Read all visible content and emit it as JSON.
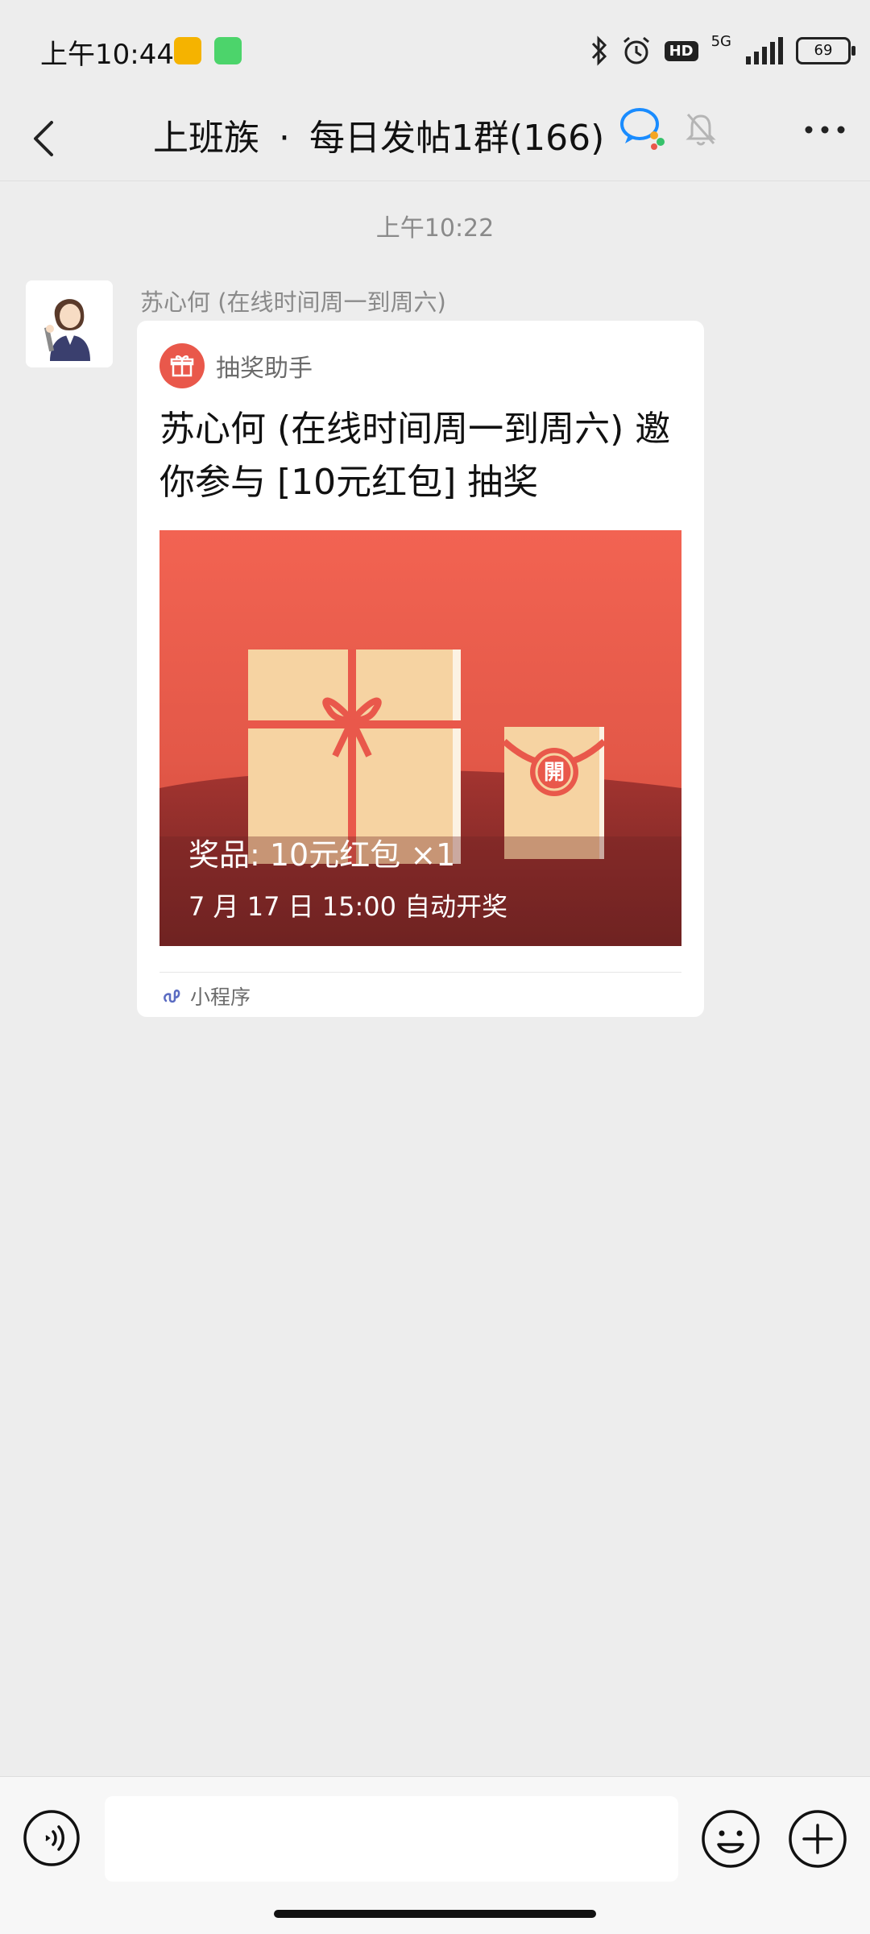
{
  "status_bar": {
    "time": "上午10:44",
    "network": "5G",
    "hd": "HD",
    "battery": "69"
  },
  "nav": {
    "group_prefix": "上班族",
    "separator": "·",
    "group_name": "每日发帖1群(166)"
  },
  "chat": {
    "time_divider": "上午10:22",
    "sender_name": "苏心何 (在线时间周一到周六)",
    "card": {
      "source_name": "抽奖助手",
      "title": "苏心何 (在线时间周一到周六) 邀你参与 [10元红包] 抽奖",
      "prize_text": "奖品: 10元红包 ×1",
      "draw_time_text": "7 月 17 日 15:00 自动开奖",
      "envelope_char": "開",
      "mini_program_label": "小程序"
    }
  },
  "input_bar": {
    "placeholder": ""
  },
  "colors": {
    "accent_red": "#e9584b",
    "chat_background": "#ededed",
    "gift_tan": "#f6d3a2"
  }
}
